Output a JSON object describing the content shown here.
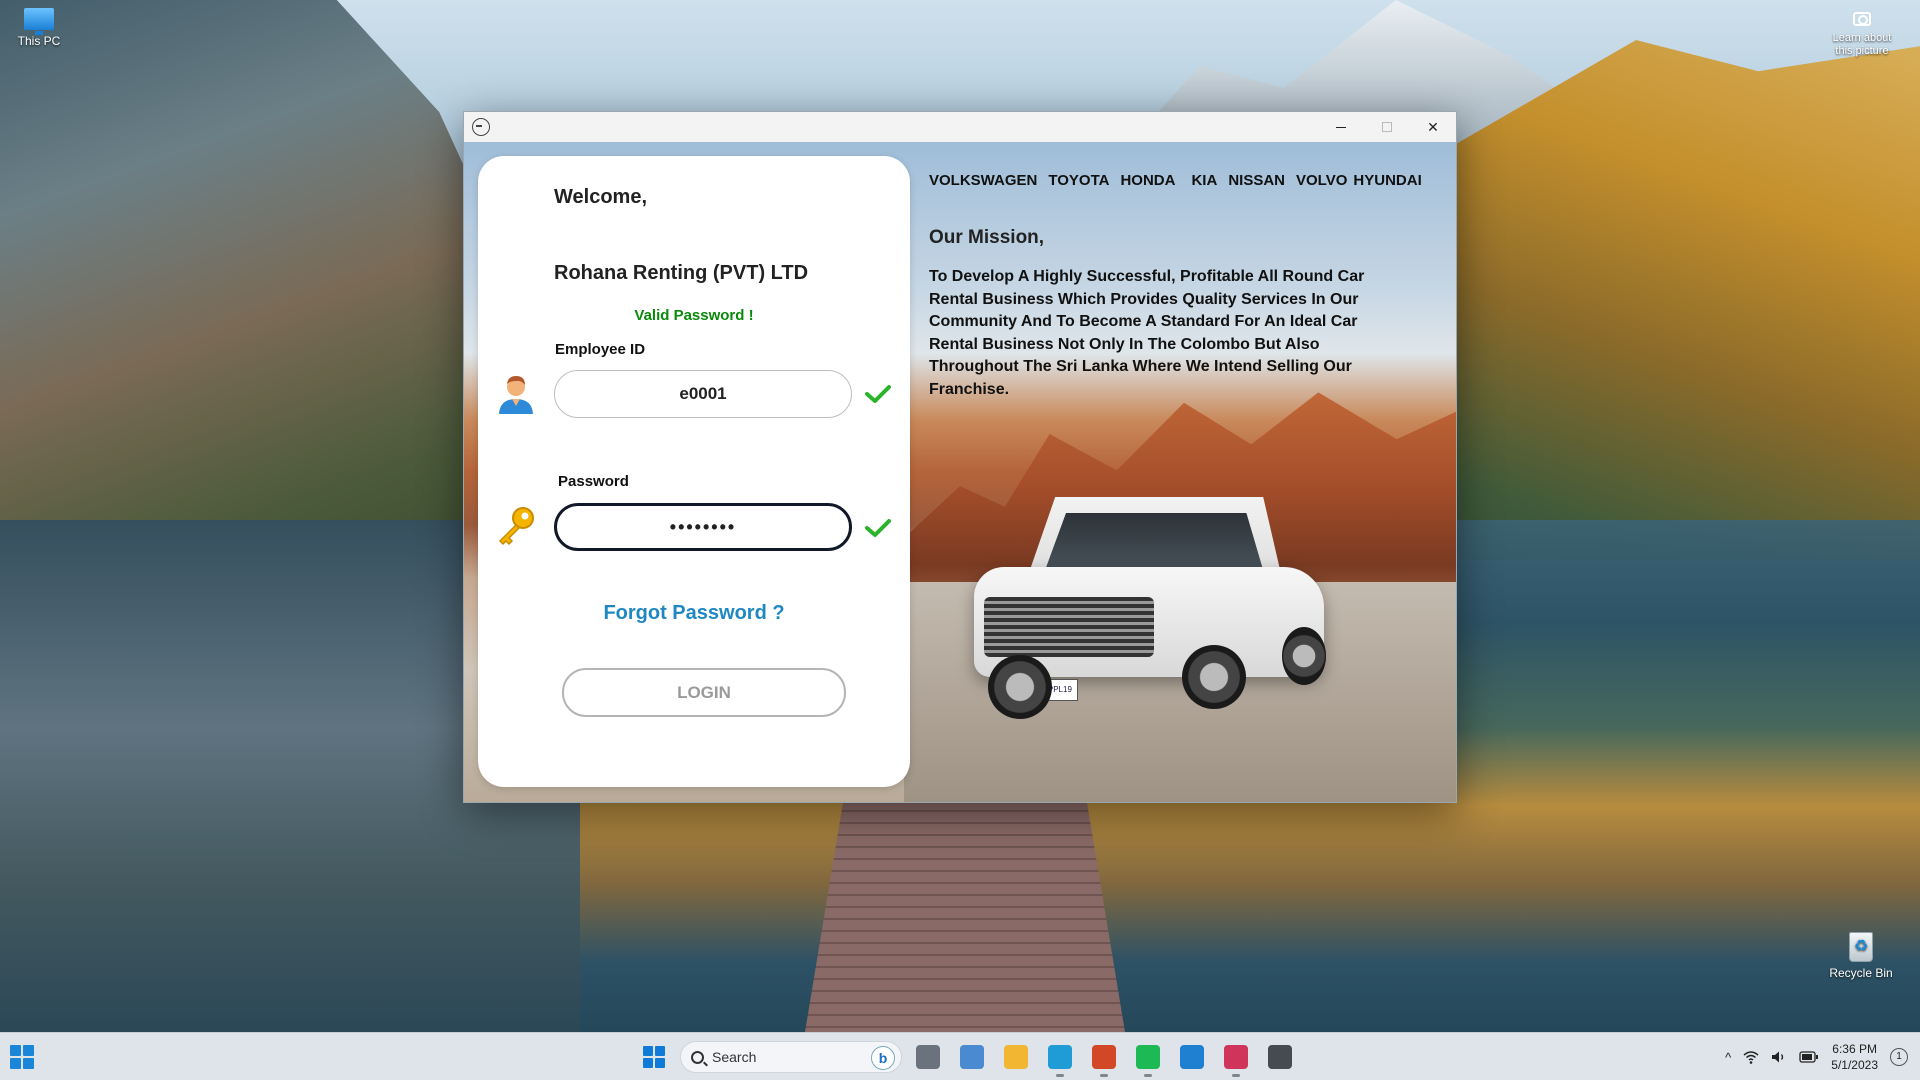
{
  "desktop": {
    "this_pc_label": "This PC",
    "learn_label": "Learn about this picture",
    "recycle_bin_label": "Recycle Bin"
  },
  "window": {
    "title_icon": "back-circle-icon",
    "minimize_glyph": "—",
    "maximize_glyph": "□",
    "close_glyph": "✕"
  },
  "login": {
    "welcome": "Welcome,",
    "company": "Rohana Renting (PVT) LTD",
    "validation_message": "Valid Password !",
    "employee_id_label": "Employee ID",
    "employee_id_value": "e0001",
    "password_label": "Password",
    "password_value": "••••••••",
    "forgot_password": "Forgot Password ?",
    "login_button": "LOGIN",
    "valid_color": "#0a8a0a",
    "link_color": "#1f88c2"
  },
  "info": {
    "brands": [
      "VOLKSWAGEN",
      "TOYOTA",
      "HONDA",
      "KIA",
      "NISSAN",
      "VOLVO",
      "HYUNDAI"
    ],
    "mission_title": "Our Mission,",
    "mission_body": "To Develop A Highly Successful, Profitable All Round Car Rental Business Which Provides Quality Services In Our Community And To Become A Standard For An Ideal Car Rental Business Not Only In The Colombo But Also Throughout The Sri Lanka Where We Intend Selling Our Franchise.",
    "plate_text": "8EPPL19"
  },
  "taskbar": {
    "search_placeholder": "Search",
    "bing_glyph": "b",
    "time": "6:36 PM",
    "date": "5/1/2023",
    "notification_count": "1",
    "tray_chevron": "^",
    "apps": [
      {
        "name": "task-view-icon",
        "color": "#6a737d",
        "state": ""
      },
      {
        "name": "task-manager-icon",
        "color": "#4a8ad0",
        "state": ""
      },
      {
        "name": "file-explorer-icon",
        "color": "#f2b632",
        "state": ""
      },
      {
        "name": "edge-icon",
        "color": "#1f9bd6",
        "state": "running"
      },
      {
        "name": "powerpoint-icon",
        "color": "#d24726",
        "state": "running"
      },
      {
        "name": "spotify-icon",
        "color": "#1db954",
        "state": "running"
      },
      {
        "name": "vscode-icon",
        "color": "#1f7fd1",
        "state": ""
      },
      {
        "name": "intellij-icon",
        "color": "#d0345a",
        "state": "running"
      },
      {
        "name": "java-app-icon",
        "color": "#444b52",
        "state": "active"
      }
    ]
  }
}
